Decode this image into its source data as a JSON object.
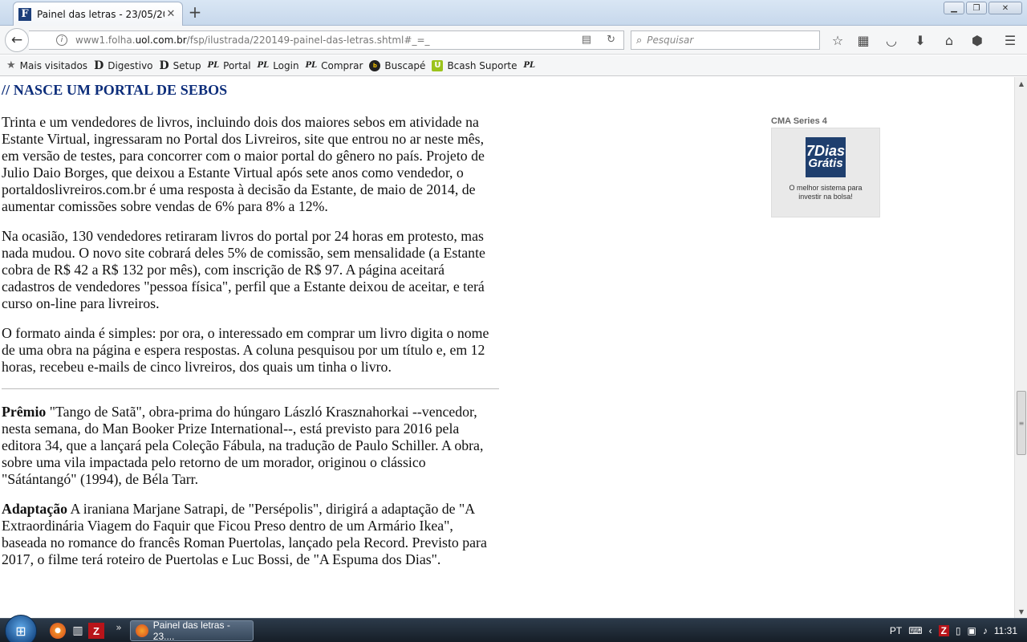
{
  "browser": {
    "tab_title": "Painel das letras - 23/05/20...",
    "tab_favicon": "F",
    "new_tab": "+",
    "url": {
      "host": "www1.folha.",
      "domain": "uol.com.br",
      "path": "/fsp/ilustrada/220149-painel-das-letras.shtml#_=_"
    },
    "search_placeholder": "Pesquisar"
  },
  "bookmarks": [
    {
      "label": "Mais visitados",
      "icon": "star-icon",
      "glyph": "★"
    },
    {
      "label": "Digestivo",
      "icon": "digestivo-icon",
      "glyph": "D"
    },
    {
      "label": "Setup",
      "icon": "digestivo-icon",
      "glyph": "D"
    },
    {
      "label": "Portal",
      "icon": "pl-icon",
      "glyph": "PL"
    },
    {
      "label": "Login",
      "icon": "pl-icon",
      "glyph": "PL"
    },
    {
      "label": "Comprar",
      "icon": "pl-icon",
      "glyph": "PL"
    },
    {
      "label": "Buscapé",
      "icon": "buscape-icon",
      "glyph": "b"
    },
    {
      "label": "Bcash Suporte",
      "icon": "bcash-icon",
      "glyph": "U"
    },
    {
      "label": "",
      "icon": "pl-icon",
      "glyph": "PL"
    }
  ],
  "article": {
    "heading": "// NASCE UM PORTAL DE SEBOS",
    "paragraphs": [
      "Trinta e um vendedores de livros, incluindo dois dos maiores sebos em atividade na Estante Virtual, ingressaram no Portal dos Livreiros, site que entrou no ar neste mês, em versão de testes, para concorrer com o maior portal do gênero no país. Projeto de Julio Daio Borges, que deixou a Estante Virtual após sete anos como vendedor, o portaldoslivreiros.com.br é uma resposta à decisão da Estante, de maio de 2014, de aumentar comissões sobre vendas de 6% para 8% a 12%.",
      "Na ocasião, 130 vendedores retiraram livros do portal por 24 horas em protesto, mas nada mudou. O novo site cobrará deles 5% de comissão, sem mensalidade (a Estante cobra de R$ 42 a R$ 132 por mês), com inscrição de R$ 97. A página aceitará cadastros de vendedores \"pessoa física\", perfil que a Estante deixou de aceitar, e terá curso on-line para livreiros.",
      "O formato ainda é simples: por ora, o interessado em comprar um livro digita o nome de uma obra na página e espera respostas. A coluna pesquisou por um título e, em 12 horas, recebeu e-mails de cinco livreiros, dos quais um tinha o livro."
    ],
    "notes": [
      {
        "title": "Prêmio",
        "text": " \"Tango de Satã\", obra-prima do húngaro László Krasznahorkai --vencedor, nesta semana, do Man Booker Prize International--, está previsto para 2016 pela editora 34, que a lançará pela Coleção Fábula, na tradução de Paulo Schiller. A obra, sobre uma vila impactada pelo retorno de um morador, originou o clássico \"Sátántangó\" (1994), de Béla Tarr."
      },
      {
        "title": "Adaptação",
        "text": " A iraniana Marjane Satrapi, de \"Persépolis\", dirigirá a adaptação de \"A Extraordinária Viagem do Faquir que Ficou Preso dentro de um Armário Ikea\", baseada no romance do francês Roman Puertolas, lançado pela Record. Previsto para 2017, o filme terá roteiro de Puertolas e Luc Bossi, de \"A Espuma dos Dias\"."
      }
    ]
  },
  "ad": {
    "label": "CMA Series 4",
    "badge_line1": "7Dias",
    "badge_line2": "Grátis",
    "tagline": "O melhor sistema para investir na bolsa!"
  },
  "taskbar": {
    "task_label": "Painel das letras - 23....",
    "language": "PT",
    "clock": "11:31",
    "more": "»"
  },
  "colors": {
    "heading": "#0c2d7a",
    "ad_badge": "#1f3f6e"
  }
}
